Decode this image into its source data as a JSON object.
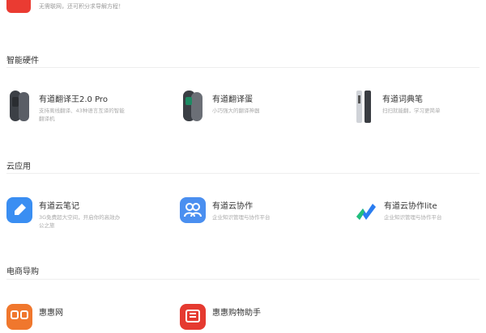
{
  "top_item": {
    "desc": "无需联网，还可积分求导解方程！"
  },
  "sections": [
    {
      "title": "智能硬件"
    },
    {
      "title": "云应用"
    },
    {
      "title": "电商导购"
    }
  ],
  "hardware": [
    {
      "title": "有道翻译王2.0 Pro",
      "desc": "支持离线翻译、43种语言互译的智能翻译机",
      "icon": "translator-device-icon"
    },
    {
      "title": "有道翻译蛋",
      "desc": "小巧强大的翻译神器",
      "icon": "translate-egg-icon"
    },
    {
      "title": "有道词典笔",
      "desc": "扫扫就能翻，学习更简单",
      "icon": "dictionary-pen-icon"
    }
  ],
  "cloud": [
    {
      "title": "有道云笔记",
      "desc": "3G免费超大空间，开启你的高效办公之旅",
      "icon": "cloud-note-icon"
    },
    {
      "title": "有道云协作",
      "desc": "企业知识管理与协作平台",
      "icon": "cloud-collab-icon"
    },
    {
      "title": "有道云协作lite",
      "desc": "企业知识管理与协作平台",
      "icon": "cloud-collab-lite-icon"
    }
  ],
  "shopping": [
    {
      "title": "惠惠网",
      "icon": "huihui-icon"
    },
    {
      "title": "惠惠购物助手",
      "icon": "huihui-assistant-icon"
    }
  ],
  "colors": {
    "red": "#ea3b32",
    "blue": "#3a8ef2",
    "orange": "#f0772d"
  }
}
